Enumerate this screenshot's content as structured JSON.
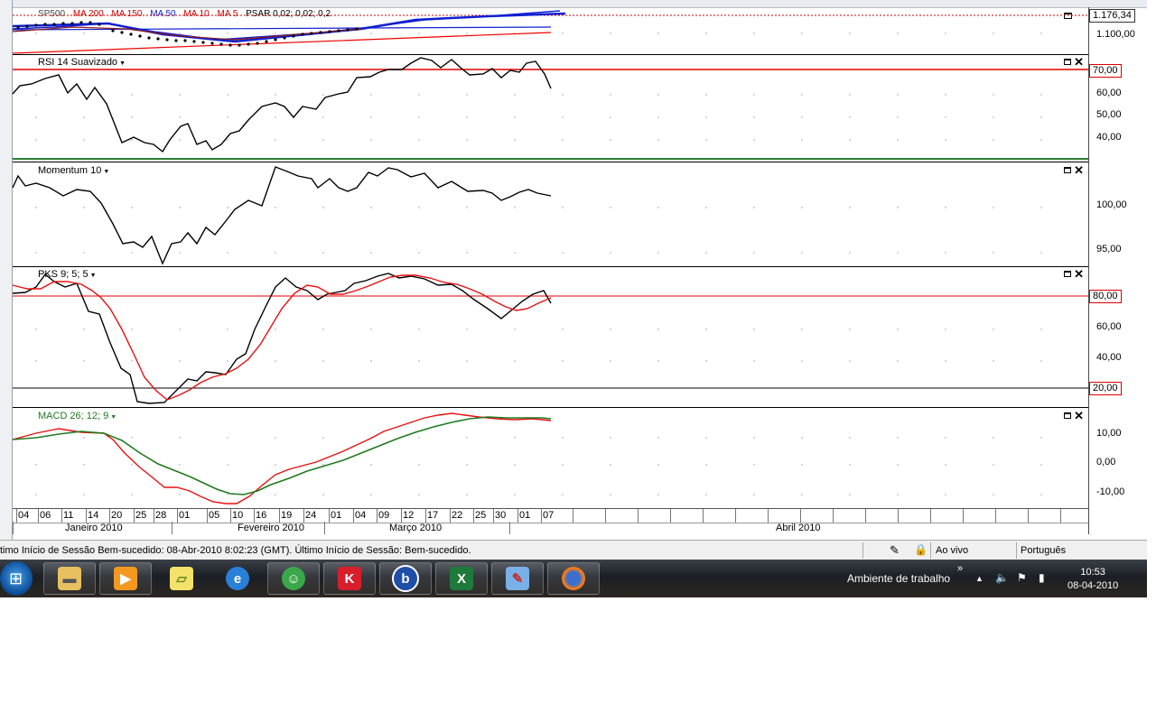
{
  "header": {
    "symbol": "SP500",
    "indicators": [
      "MA 200",
      "MA 150",
      "MA 50",
      "MA 10",
      "MA 5",
      "PSAR 0,02; 0,02; 0,2"
    ],
    "price_label": "1.176,34",
    "y_tick": "1.100,00"
  },
  "panes": {
    "rsi": {
      "label": "RSI 14 Suavizado",
      "level": "70,00",
      "ticks": [
        "60,00",
        "50,00",
        "40,00"
      ]
    },
    "momentum": {
      "label": "Momentum 10",
      "ticks": [
        "100,00",
        "95,00"
      ]
    },
    "pks": {
      "label": "PKS 9; 5; 5",
      "level_high": "80,00",
      "level_low": "20,00",
      "ticks": [
        "60,00",
        "40,00"
      ]
    },
    "macd": {
      "label": "MACD 26; 12; 9",
      "ticks": [
        "10,00",
        "0,00",
        "-10,00"
      ]
    }
  },
  "dates": [
    "04",
    "06",
    "11",
    "14",
    "20",
    "25",
    "28",
    "01",
    "05",
    "10",
    "16",
    "19",
    "24",
    "01",
    "04",
    "09",
    "12",
    "17",
    "22",
    "25",
    "30",
    "01",
    "07"
  ],
  "months": [
    "Janeiro 2010",
    "Fevereiro 2010",
    "Março 2010",
    "Abril 2010"
  ],
  "status": {
    "message": "timo Início de Sessão Bem-sucedido: 08-Abr-2010 8:02:23 (GMT). Último Início de Sessão: Bem-sucedido.",
    "live": "Ao vivo",
    "language": "Português"
  },
  "taskbar": {
    "desktop_label": "Ambiente de trabalho",
    "time": "10:53",
    "date": "08-04-2010"
  },
  "colors": {
    "rsi_line": "#000000",
    "signal_red": "#e81010",
    "macd_green": "#1f7a1f",
    "level_red": "#d00000",
    "ma_blue": "#1020d0"
  }
}
